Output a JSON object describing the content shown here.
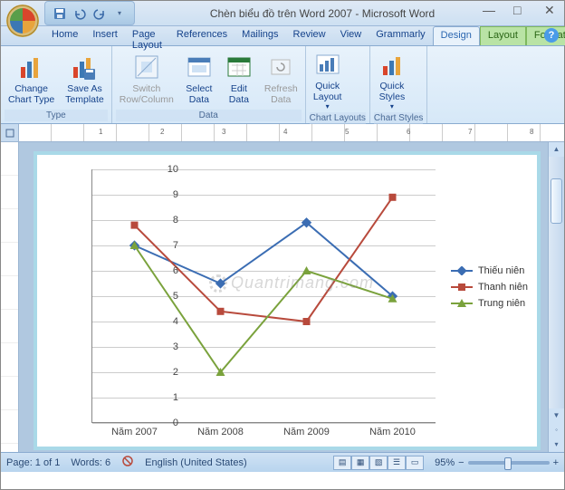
{
  "title": "Chèn biểu đồ trên Word 2007 - Microsoft Word",
  "qat": {
    "save": "save-icon",
    "undo": "undo-icon",
    "redo": "redo-icon"
  },
  "tabs": [
    "Home",
    "Insert",
    "Page Layout",
    "References",
    "Mailings",
    "Review",
    "View",
    "Grammarly",
    "Design",
    "Layout",
    "Format"
  ],
  "active_tab": "Design",
  "ribbon": {
    "groups": [
      {
        "label": "Type",
        "items": [
          {
            "name": "change-chart-type",
            "label": "Change\nChart Type"
          },
          {
            "name": "save-as-template",
            "label": "Save As\nTemplate"
          }
        ]
      },
      {
        "label": "Data",
        "items": [
          {
            "name": "switch-row-column",
            "label": "Switch\nRow/Column",
            "disabled": true
          },
          {
            "name": "select-data",
            "label": "Select\nData"
          },
          {
            "name": "edit-data",
            "label": "Edit\nData"
          },
          {
            "name": "refresh-data",
            "label": "Refresh\nData",
            "disabled": true
          }
        ]
      },
      {
        "label": "Chart Layouts",
        "items": [
          {
            "name": "quick-layout",
            "label": "Quick\nLayout",
            "dd": true
          }
        ]
      },
      {
        "label": "Chart Styles",
        "items": [
          {
            "name": "quick-styles",
            "label": "Quick\nStyles",
            "dd": true
          }
        ]
      }
    ]
  },
  "chart_data": {
    "type": "line",
    "categories": [
      "Năm 2007",
      "Năm 2008",
      "Năm 2009",
      "Năm 2010"
    ],
    "series": [
      {
        "name": "Thiếu niên",
        "color": "#3b6db3",
        "values": [
          7.0,
          5.5,
          7.9,
          5.0
        ]
      },
      {
        "name": "Thanh niên",
        "color": "#b84a3c",
        "values": [
          7.8,
          4.4,
          4.0,
          8.9
        ]
      },
      {
        "name": "Trung niên",
        "color": "#7aa23c",
        "values": [
          7.0,
          2.0,
          6.0,
          4.9
        ]
      }
    ],
    "ylim": [
      0,
      10
    ],
    "yticks": [
      0,
      1,
      2,
      3,
      4,
      5,
      6,
      7,
      8,
      9,
      10
    ],
    "xlabel": "",
    "ylabel": "",
    "title": ""
  },
  "status": {
    "page": "Page: 1 of 1",
    "words": "Words: 6",
    "lang": "English (United States)",
    "zoom": "95%"
  },
  "watermark": "Quantrimang.com"
}
